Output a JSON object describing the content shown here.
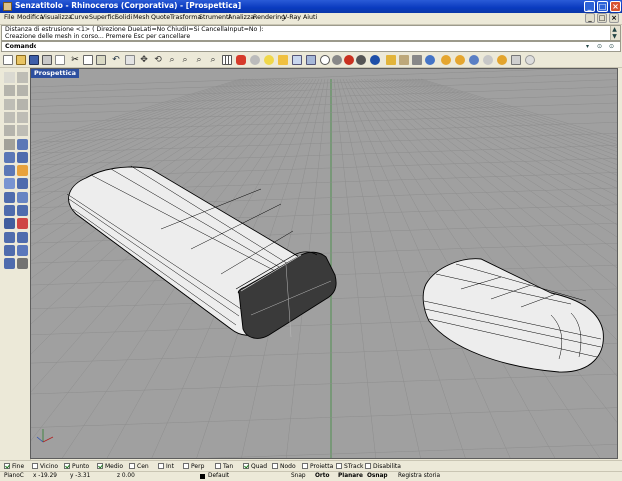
{
  "window": {
    "title": "Senzatitolo - Rhinoceros (Corporativa) - [Prospettica]",
    "controls": [
      "_",
      "□",
      "×"
    ],
    "doc_controls": [
      "_",
      "□",
      "×"
    ]
  },
  "menu": [
    "File",
    "Modifica",
    "Visualizza",
    "Curve",
    "Superfici",
    "Solidi",
    "Mesh",
    "Quote",
    "Trasforma",
    "Strumenti",
    "Analizza",
    "Rendering",
    "V-Ray",
    "Aiuti"
  ],
  "command_history": [
    "Distanza di estrusione <1> ( Direzione  DueLati=No  ChiudiI=Si  CancellaInput=No ):",
    "Creazione delle mesh in corso... Premere Esc per cancellare"
  ],
  "command_prompt": {
    "label": "Comando:",
    "value": ""
  },
  "viewport": {
    "label": "Prospettica",
    "background": "#a0a0a0",
    "grid_color": "#8e8e8e",
    "grid_axis_x": "#9b3b3b",
    "grid_axis_y": "#3b8b3b"
  },
  "osnap": [
    {
      "label": "Fine",
      "checked": true
    },
    {
      "label": "Vicino",
      "checked": false
    },
    {
      "label": "Punto",
      "checked": true
    },
    {
      "label": "Medio",
      "checked": true
    },
    {
      "label": "Cen",
      "checked": false
    },
    {
      "label": "Int",
      "checked": false
    },
    {
      "label": "Perp",
      "checked": false
    },
    {
      "label": "Tan",
      "checked": false
    },
    {
      "label": "Quad",
      "checked": true
    },
    {
      "label": "Nodo",
      "checked": false
    },
    {
      "label": "Proietta",
      "checked": false
    },
    {
      "label": "STrack",
      "checked": false
    },
    {
      "label": "Disabilita",
      "checked": false
    }
  ],
  "status": {
    "cplane": "PianoC",
    "x": "x -19.29",
    "y": "y -3.31",
    "z": "z 0.00",
    "layer": "Default",
    "snap": "Snap",
    "orto": "Orto",
    "planare": "Planare",
    "osnap": "Osnap",
    "history": "Registra storia"
  },
  "icons": {
    "title": "rhino-app-icon",
    "scroll": [
      "arrow-up-icon",
      "arrow-down-icon"
    ],
    "command": [
      "dropdown-icon",
      "arrow-up-icon",
      "arrow-down-icon"
    ]
  }
}
